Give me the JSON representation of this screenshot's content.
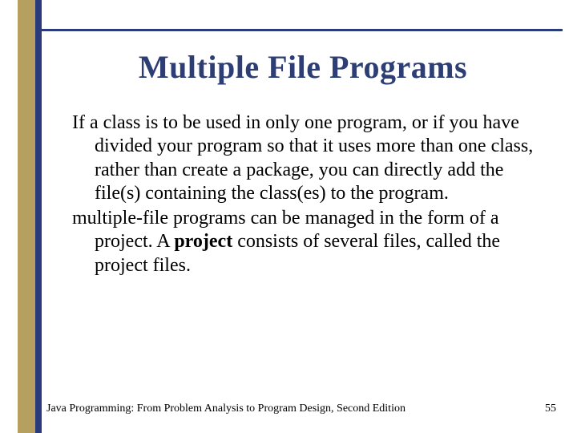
{
  "title": "Multiple File Programs",
  "body": {
    "para1_pre": "If a class is to be used in only one program, or if you have divided your program so that it uses more than one class, rather than create a package, you can directly add the file(s) containing the class(es) to the program.",
    "para2_pre": "multiple-file programs can be managed in the form of a project.  A ",
    "project_word": "project",
    "para2_post": " consists of several files, called the project files."
  },
  "footer": {
    "text": "Java Programming: From Problem Analysis to Program Design, Second Edition",
    "page": "55"
  },
  "colors": {
    "gold": "#b6a060",
    "blue": "#2a3a7a",
    "title": "#2d3e75"
  }
}
